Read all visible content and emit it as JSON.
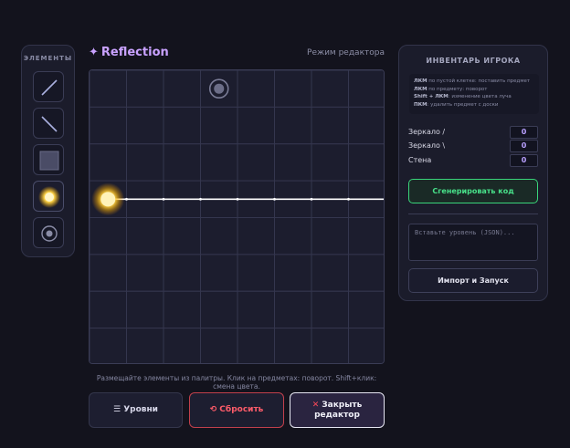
{
  "palette": {
    "title": "ЭЛЕМЕНТЫ",
    "tools": [
      {
        "name": "mirror-slash-tool",
        "icon": "mirror-slash"
      },
      {
        "name": "mirror-backslash-tool",
        "icon": "mirror-backslash"
      },
      {
        "name": "wall-tool",
        "icon": "wall"
      },
      {
        "name": "light-source-tool",
        "icon": "light-source"
      },
      {
        "name": "target-tool",
        "icon": "target"
      }
    ],
    "active_index": 3
  },
  "header": {
    "title": "Reflection",
    "mode_label": "Режим редактора"
  },
  "board": {
    "cols": 8,
    "rows": 8,
    "source": {
      "col": 0,
      "row": 3
    },
    "target": {
      "col": 3,
      "row": 0
    },
    "beam": {
      "row": 3,
      "from_col": 0,
      "to_col": 8
    },
    "colors": {
      "grid": "#34364e",
      "cell": "#1c1d2e",
      "beam": "#ffffff",
      "glow": "#ffc93a"
    }
  },
  "hint": "Размещайте элементы из палитры. Клик на предметах: поворот. Shift+клик: смена цвета.",
  "buttons": {
    "levels": "☰ Уровни",
    "reset": "⟲ Сбросить",
    "close_line1": "Закрыть",
    "close_line2": "редактор",
    "close_icon": "✕"
  },
  "inventory": {
    "title": "ИНВЕНТАРЬ ИГРОКА",
    "help": [
      {
        "key": "ЛКМ",
        "text": " по пустой клетке: поставить предмет"
      },
      {
        "key": "ЛКМ",
        "text": " по предмету: поворот"
      },
      {
        "key": "Shift + ЛКМ",
        "text": ": изменение цвета луча"
      },
      {
        "key": "ПКМ",
        "text": ": удалить предмет с доски"
      }
    ],
    "items": [
      {
        "label": "Зеркало /",
        "count": "0"
      },
      {
        "label": "Зеркало \\",
        "count": "0"
      },
      {
        "label": "Стена",
        "count": "0"
      }
    ],
    "generate_label": "Сгенерировать код",
    "json_placeholder": "Вставьте уровень (JSON)...",
    "import_label": "Импорт и Запуск"
  }
}
